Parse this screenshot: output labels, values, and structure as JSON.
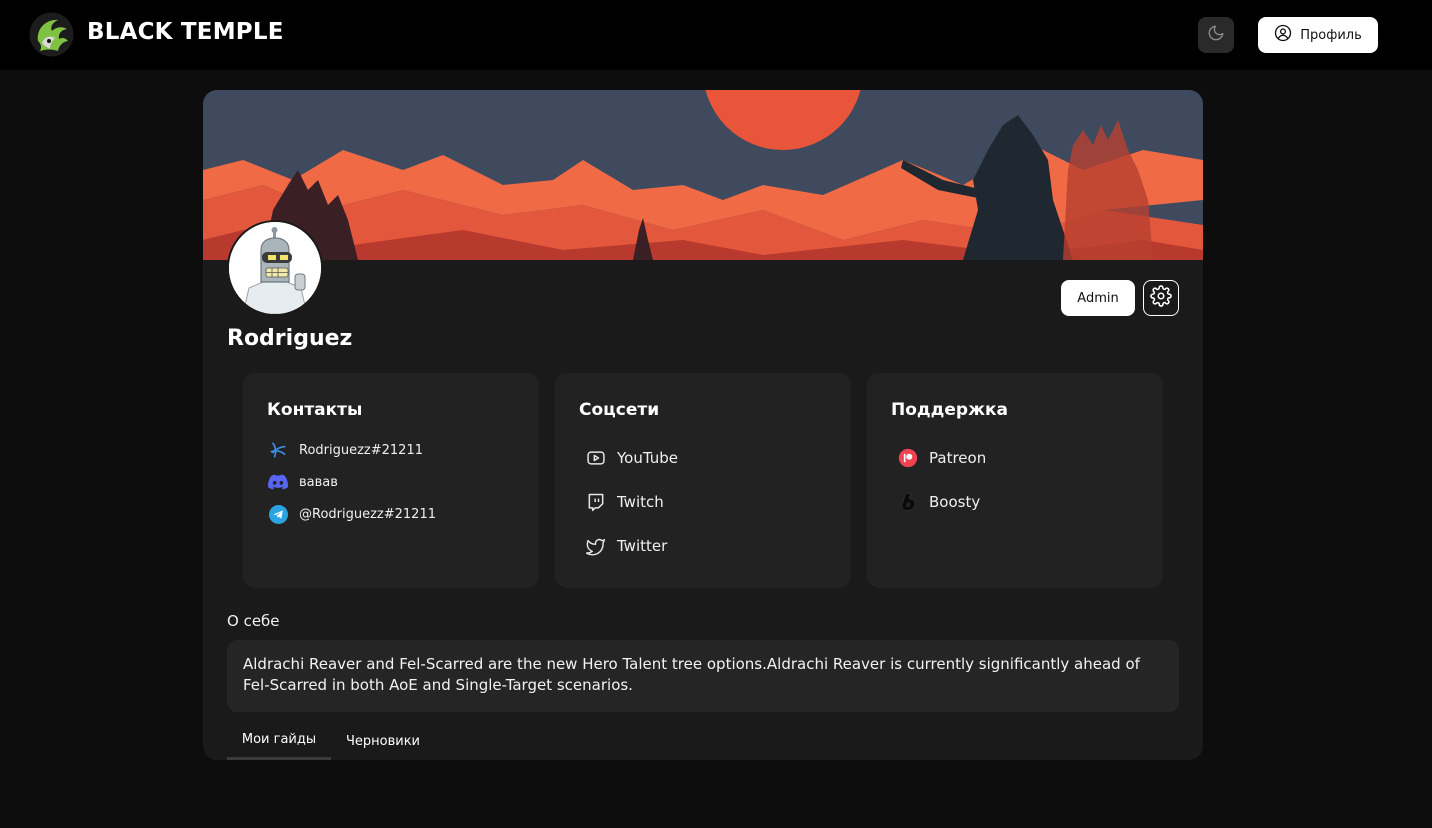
{
  "header": {
    "brand": "BLACK TEMPLE",
    "profile_label": "Профиль"
  },
  "profile": {
    "username": "Rodriguez",
    "role_label": "Admin"
  },
  "contacts": {
    "title": "Контакты",
    "items": [
      {
        "icon": "battlenet-icon",
        "value": "Rodriguezz#21211"
      },
      {
        "icon": "discord-icon",
        "value": "вавав"
      },
      {
        "icon": "telegram-icon",
        "value": "@Rodriguezz#21211"
      }
    ]
  },
  "socials": {
    "title": "Соцсети",
    "items": [
      {
        "icon": "youtube-icon",
        "label": "YouTube"
      },
      {
        "icon": "twitch-icon",
        "label": "Twitch"
      },
      {
        "icon": "twitter-icon",
        "label": "Twitter"
      }
    ]
  },
  "support": {
    "title": "Поддержка",
    "items": [
      {
        "icon": "patreon-icon",
        "label": "Patreon"
      },
      {
        "icon": "boosty-icon",
        "label": "Boosty"
      }
    ]
  },
  "about": {
    "title": "О себе",
    "text": "Aldrachi Reaver and Fel-Scarred are the new Hero Talent tree options.Aldrachi Reaver is currently significantly ahead of Fel-Scarred in both AoE and Single-Target scenarios."
  },
  "tabs": [
    {
      "label": "Мои гайды",
      "active": true
    },
    {
      "label": "Черновики",
      "active": false
    }
  ],
  "colors": {
    "page_bg": "#0d0d0d",
    "card_bg": "#1a1a1a",
    "panel_bg": "#222222",
    "banner_sky": "#3f4a5e",
    "banner_sun": "#e8553a",
    "logo_green": "#7fc241"
  }
}
